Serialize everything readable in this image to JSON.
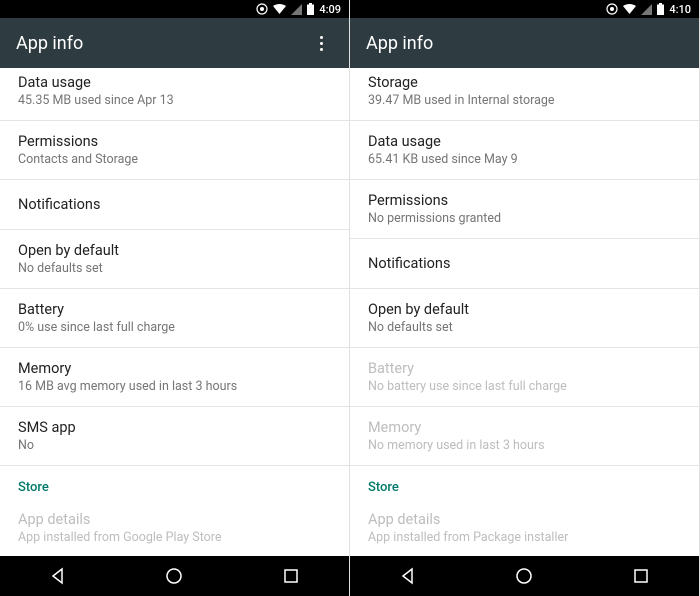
{
  "panes": [
    {
      "status": {
        "time": "4:09"
      },
      "appbar": {
        "title": "App info",
        "has_overflow": true
      },
      "items": [
        {
          "title": "Data usage",
          "sub": "45.35 MB used since Apr 13",
          "first": true
        },
        {
          "title": "Permissions",
          "sub": "Contacts and Storage"
        },
        {
          "title": "Notifications",
          "no_sub": true
        },
        {
          "title": "Open by default",
          "sub": "No defaults set"
        },
        {
          "title": "Battery",
          "sub": "0% use since last full charge"
        },
        {
          "title": "Memory",
          "sub": "16 MB avg memory used in last 3 hours"
        },
        {
          "title": "SMS app",
          "sub": "No"
        }
      ],
      "section": "Store",
      "footer_item": {
        "title": "App details",
        "sub": "App installed from Google Play Store",
        "disabled": true
      }
    },
    {
      "status": {
        "time": "4:10"
      },
      "appbar": {
        "title": "App info",
        "has_overflow": false
      },
      "items": [
        {
          "title": "Storage",
          "sub": "39.47 MB used in Internal storage",
          "first": true
        },
        {
          "title": "Data usage",
          "sub": "65.41 KB used since May 9"
        },
        {
          "title": "Permissions",
          "sub": "No permissions granted"
        },
        {
          "title": "Notifications",
          "no_sub": true
        },
        {
          "title": "Open by default",
          "sub": "No defaults set"
        },
        {
          "title": "Battery",
          "sub": "No battery use since last full charge",
          "disabled": true
        },
        {
          "title": "Memory",
          "sub": "No memory used in last 3 hours",
          "disabled": true
        }
      ],
      "section": "Store",
      "footer_item": {
        "title": "App details",
        "sub": "App installed from Package installer",
        "disabled": true
      }
    }
  ]
}
